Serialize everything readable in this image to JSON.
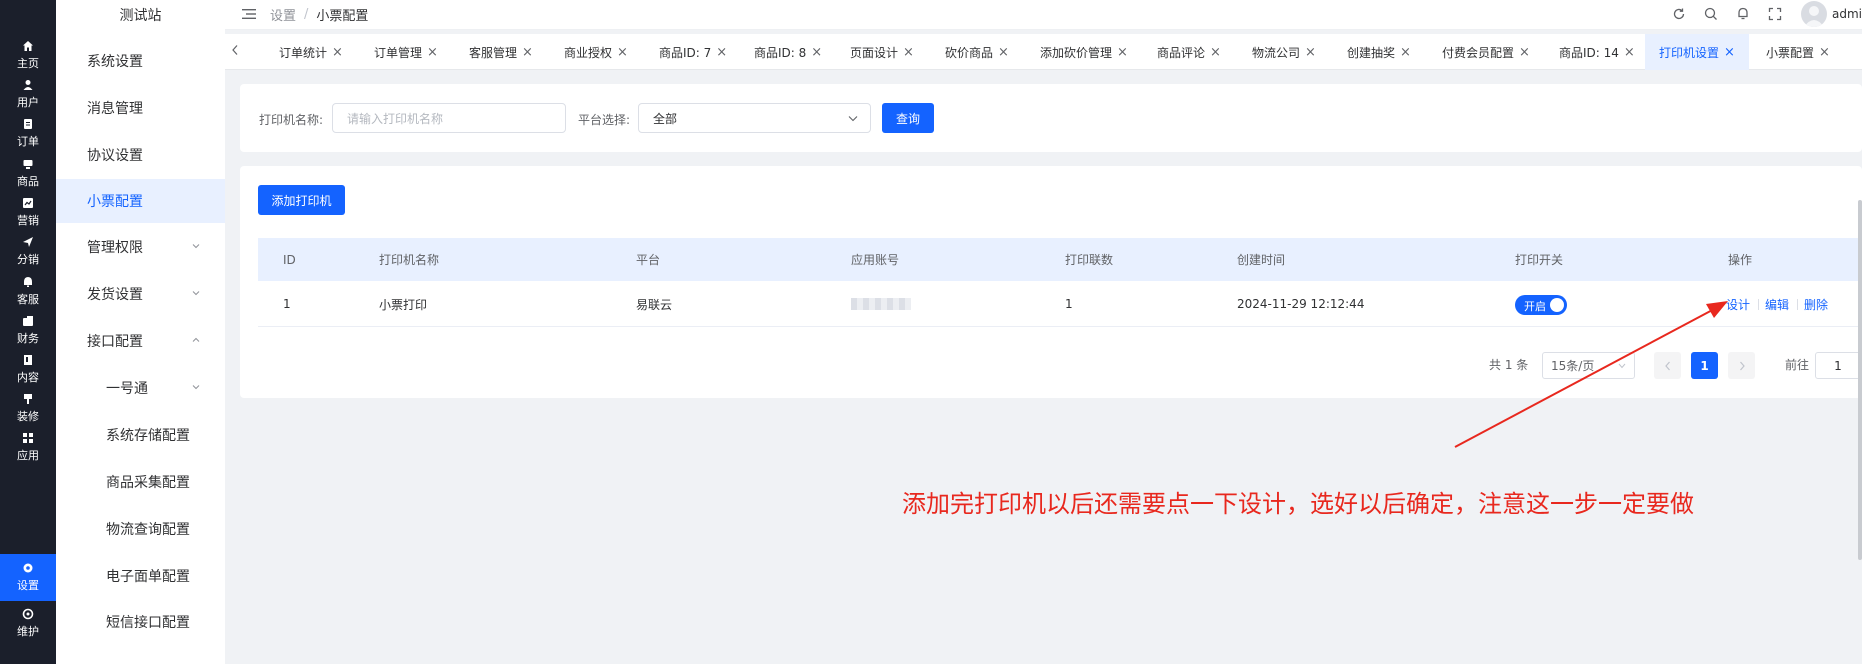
{
  "rail": {
    "items": [
      {
        "label": "主页",
        "icon": "home-icon"
      },
      {
        "label": "用户",
        "icon": "user-icon"
      },
      {
        "label": "订单",
        "icon": "order-icon"
      },
      {
        "label": "商品",
        "icon": "product-icon"
      },
      {
        "label": "营销",
        "icon": "marketing-icon"
      },
      {
        "label": "分销",
        "icon": "distribution-icon"
      },
      {
        "label": "客服",
        "icon": "service-icon"
      },
      {
        "label": "财务",
        "icon": "finance-icon"
      },
      {
        "label": "内容",
        "icon": "content-icon"
      },
      {
        "label": "装修",
        "icon": "decorate-icon"
      },
      {
        "label": "应用",
        "icon": "apps-icon"
      },
      {
        "label": "设置",
        "icon": "gear-icon"
      },
      {
        "label": "维护",
        "icon": "maintain-icon"
      }
    ],
    "active": "设置"
  },
  "sidebar": {
    "site_name": "测试站",
    "items": [
      {
        "label": "系统设置"
      },
      {
        "label": "消息管理"
      },
      {
        "label": "协议设置"
      },
      {
        "label": "小票配置"
      },
      {
        "label": "管理权限"
      },
      {
        "label": "发货设置"
      },
      {
        "label": "接口配置"
      },
      {
        "label": "一号通"
      },
      {
        "label": "系统存储配置"
      },
      {
        "label": "商品采集配置"
      },
      {
        "label": "物流查询配置"
      },
      {
        "label": "电子面单配置"
      },
      {
        "label": "短信接口配置"
      }
    ],
    "active": "小票配置"
  },
  "header": {
    "breadcrumb": [
      "设置",
      "小票配置"
    ],
    "separator": "/",
    "user_name": "admin"
  },
  "tabs": [
    {
      "label": "订单统计"
    },
    {
      "label": "订单管理"
    },
    {
      "label": "客服管理"
    },
    {
      "label": "商业授权"
    },
    {
      "label": "商品ID: 7"
    },
    {
      "label": "商品ID: 8"
    },
    {
      "label": "页面设计"
    },
    {
      "label": "砍价商品"
    },
    {
      "label": "添加砍价管理"
    },
    {
      "label": "商品评论"
    },
    {
      "label": "物流公司"
    },
    {
      "label": "创建抽奖"
    },
    {
      "label": "付费会员配置"
    },
    {
      "label": "商品ID: 14"
    },
    {
      "label": "打印机设置"
    },
    {
      "label": "小票配置"
    }
  ],
  "active_tab": "打印机设置",
  "tab_close_glyph": "×",
  "search": {
    "name_label": "打印机名称:",
    "name_placeholder": "请输入打印机名称",
    "platform_label": "平台选择:",
    "platform_value": "全部",
    "query_button": "查询"
  },
  "add_button": "添加打印机",
  "table": {
    "columns": [
      "ID",
      "打印机名称",
      "平台",
      "应用账号",
      "打印联数",
      "创建时间",
      "打印开关",
      "操作"
    ],
    "rows": [
      {
        "id": "1",
        "name": "小票打印",
        "platform": "易联云",
        "account": "",
        "copies": "1",
        "created": "2024-11-29 12:12:44",
        "switch_label": "开启",
        "switch_on": true,
        "actions": [
          "设计",
          "编辑",
          "删除"
        ]
      }
    ]
  },
  "pagination": {
    "total_text": "共 1 条",
    "page_size": "15条/页",
    "current_page": "1",
    "goto_label": "前往",
    "goto_value": "1"
  },
  "annotation": {
    "text": "添加完打印机以后还需要点一下设计，选好以后确定，注意这一步一定要做",
    "color": "#e8281e"
  },
  "colors": {
    "accent": "#1463ff",
    "rail_bg": "#1b1f2b",
    "highlight_bg": "#e8f0ff"
  }
}
